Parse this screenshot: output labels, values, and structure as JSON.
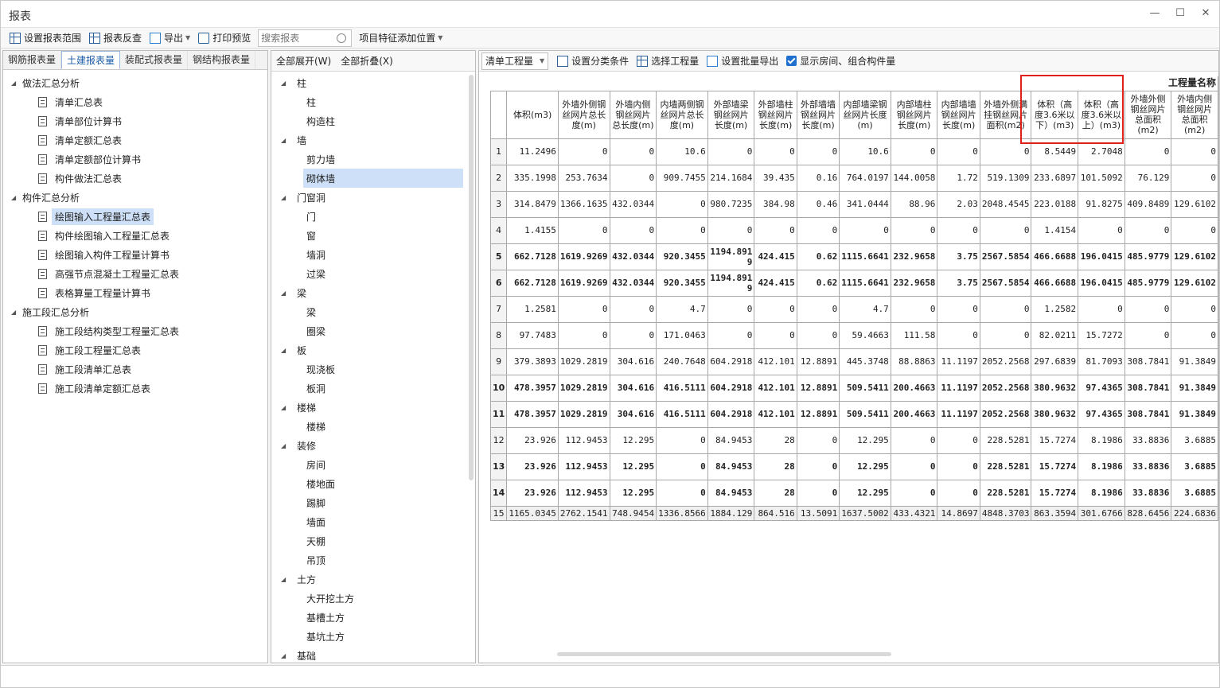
{
  "window": {
    "title": "报表"
  },
  "toolbar": {
    "set_range": "设置报表范围",
    "reverse": "报表反查",
    "export": "导出",
    "print_preview": "打印预览",
    "search_placeholder": "搜索报表",
    "feature_position": "项目特征添加位置"
  },
  "tabs": [
    "钢筋报表量",
    "土建报表量",
    "装配式报表量",
    "钢结构报表量"
  ],
  "tree": [
    {
      "label": "做法汇总分析",
      "children": [
        "清单汇总表",
        "清单部位计算书",
        "清单定额汇总表",
        "清单定额部位计算书",
        "构件做法汇总表"
      ]
    },
    {
      "label": "构件汇总分析",
      "children": [
        "绘图输入工程量汇总表",
        "构件绘图输入工程量汇总表",
        "绘图输入构件工程量计算书",
        "高强节点混凝土工程量汇总表",
        "表格算量工程量计算书"
      ]
    },
    {
      "label": "施工段汇总分析",
      "children": [
        "施工段结构类型工程量汇总表",
        "施工段工程量汇总表",
        "施工段清单汇总表",
        "施工段清单定额汇总表"
      ]
    }
  ],
  "middle": {
    "expand_all": "全部展开(W)",
    "collapse_all": "全部折叠(X)",
    "categories": [
      {
        "label": "柱",
        "children": [
          "柱",
          "构造柱"
        ]
      },
      {
        "label": "墙",
        "children": [
          "剪力墙",
          "砌体墙"
        ]
      },
      {
        "label": "门窗洞",
        "children": [
          "门",
          "窗",
          "墙洞",
          "过梁"
        ]
      },
      {
        "label": "梁",
        "children": [
          "梁",
          "圈梁"
        ]
      },
      {
        "label": "板",
        "children": [
          "现浇板",
          "板洞"
        ]
      },
      {
        "label": "楼梯",
        "children": [
          "楼梯"
        ]
      },
      {
        "label": "装修",
        "children": [
          "房间",
          "楼地面",
          "踢脚",
          "墙面",
          "天棚",
          "吊顶"
        ]
      },
      {
        "label": "土方",
        "children": [
          "大开挖土方",
          "基槽土方",
          "基坑土方"
        ]
      },
      {
        "label": "基础",
        "children": []
      }
    ]
  },
  "right_toolbar": {
    "combo": "清单工程量",
    "classify": "设置分类条件",
    "select_qty": "选择工程量",
    "batch_export": "设置批量导出",
    "show_rooms": "显示房间、组合构件量"
  },
  "table": {
    "group_header": "工程量名称",
    "headers": [
      "体积(m3)",
      "外墙外侧钢丝网片总长度(m)",
      "外墙内侧钢丝网片总长度(m)",
      "内墙两侧钢丝网片总长度(m)",
      "外部墙梁钢丝网片长度(m)",
      "外部墙柱钢丝网片长度(m)",
      "外部墙墙钢丝网片长度(m)",
      "内部墙梁钢丝网片长度(m)",
      "内部墙柱钢丝网片长度(m)",
      "内部墙墙钢丝网片长度(m)",
      "外墙外侧满挂钢丝网片面积(m2)",
      "体积（高度3.6米以下）(m3)",
      "体积（高度3.6米以上）(m3)",
      "外墙外侧钢丝网片总面积(m2)",
      "外墙内侧钢丝网片总面积(m2)"
    ],
    "rows": [
      [
        "1",
        "11.2496",
        "0",
        "0",
        "10.6",
        "0",
        "0",
        "0",
        "10.6",
        "0",
        "0",
        "0",
        "8.5449",
        "2.7048",
        "0",
        "0"
      ],
      [
        "2",
        "335.1998",
        "253.7634",
        "0",
        "909.7455",
        "214.1684",
        "39.435",
        "0.16",
        "764.0197",
        "144.0058",
        "1.72",
        "519.1309",
        "233.6897",
        "101.5092",
        "76.129",
        "0"
      ],
      [
        "3",
        "314.8479",
        "1366.1635",
        "432.0344",
        "0",
        "980.7235",
        "384.98",
        "0.46",
        "341.0444",
        "88.96",
        "2.03",
        "2048.4545",
        "223.0188",
        "91.8275",
        "409.8489",
        "129.6102"
      ],
      [
        "4",
        "1.4155",
        "0",
        "0",
        "0",
        "0",
        "0",
        "0",
        "0",
        "0",
        "0",
        "0",
        "1.4154",
        "0",
        "0",
        "0"
      ],
      [
        "5",
        "662.7128",
        "1619.9269",
        "432.0344",
        "920.3455",
        "1194.8919",
        "424.415",
        "0.62",
        "1115.6641",
        "232.9658",
        "3.75",
        "2567.5854",
        "466.6688",
        "196.0415",
        "485.9779",
        "129.6102"
      ],
      [
        "6",
        "662.7128",
        "1619.9269",
        "432.0344",
        "920.3455",
        "1194.8919",
        "424.415",
        "0.62",
        "1115.6641",
        "232.9658",
        "3.75",
        "2567.5854",
        "466.6688",
        "196.0415",
        "485.9779",
        "129.6102"
      ],
      [
        "7",
        "1.2581",
        "0",
        "0",
        "4.7",
        "0",
        "0",
        "0",
        "4.7",
        "0",
        "0",
        "0",
        "1.2582",
        "0",
        "0",
        "0"
      ],
      [
        "8",
        "97.7483",
        "0",
        "0",
        "171.0463",
        "0",
        "0",
        "0",
        "59.4663",
        "111.58",
        "0",
        "0",
        "82.0211",
        "15.7272",
        "0",
        "0"
      ],
      [
        "9",
        "379.3893",
        "1029.2819",
        "304.616",
        "240.7648",
        "604.2918",
        "412.101",
        "12.8891",
        "445.3748",
        "88.8863",
        "11.1197",
        "2052.2568",
        "297.6839",
        "81.7093",
        "308.7841",
        "91.3849"
      ],
      [
        "10",
        "478.3957",
        "1029.2819",
        "304.616",
        "416.5111",
        "604.2918",
        "412.101",
        "12.8891",
        "509.5411",
        "200.4663",
        "11.1197",
        "2052.2568",
        "380.9632",
        "97.4365",
        "308.7841",
        "91.3849"
      ],
      [
        "11",
        "478.3957",
        "1029.2819",
        "304.616",
        "416.5111",
        "604.2918",
        "412.101",
        "12.8891",
        "509.5411",
        "200.4663",
        "11.1197",
        "2052.2568",
        "380.9632",
        "97.4365",
        "308.7841",
        "91.3849"
      ],
      [
        "12",
        "23.926",
        "112.9453",
        "12.295",
        "0",
        "84.9453",
        "28",
        "0",
        "12.295",
        "0",
        "0",
        "228.5281",
        "15.7274",
        "8.1986",
        "33.8836",
        "3.6885"
      ],
      [
        "13",
        "23.926",
        "112.9453",
        "12.295",
        "0",
        "84.9453",
        "28",
        "0",
        "12.295",
        "0",
        "0",
        "228.5281",
        "15.7274",
        "8.1986",
        "33.8836",
        "3.6885"
      ],
      [
        "14",
        "23.926",
        "112.9453",
        "12.295",
        "0",
        "84.9453",
        "28",
        "0",
        "12.295",
        "0",
        "0",
        "228.5281",
        "15.7274",
        "8.1986",
        "33.8836",
        "3.6885"
      ],
      [
        "15",
        "1165.0345",
        "2762.1541",
        "748.9454",
        "1336.8566",
        "1884.129",
        "864.516",
        "13.5091",
        "1637.5002",
        "433.4321",
        "14.8697",
        "4848.3703",
        "863.3594",
        "301.6766",
        "828.6456",
        "224.6836"
      ]
    ],
    "bold_rows": [
      5,
      6,
      10,
      11,
      13,
      14
    ]
  }
}
